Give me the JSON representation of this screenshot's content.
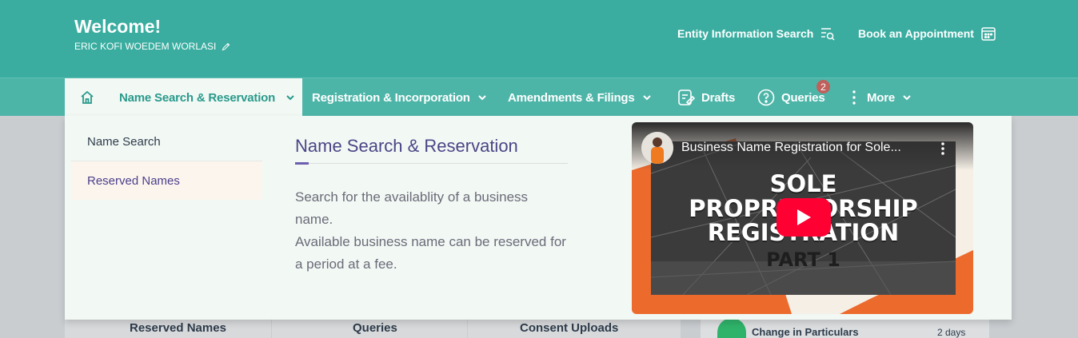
{
  "header": {
    "welcome": "Welcome!",
    "username": "ERIC KOFI WOEDEM WORLASI",
    "links": [
      {
        "label": "Entity Information Search"
      },
      {
        "label": "Book an Appointment"
      }
    ]
  },
  "nav": {
    "active_label": "Name Search & Reservation",
    "items": [
      {
        "label": "Registration & Incorporation"
      },
      {
        "label": "Amendments & Filings"
      },
      {
        "label": "Drafts"
      },
      {
        "label": "Queries"
      },
      {
        "label": "More"
      }
    ],
    "queries_badge": "2"
  },
  "dropdown": {
    "links": [
      {
        "label": "Name Search"
      },
      {
        "label": "Reserved Names"
      }
    ],
    "title": "Name Search & Reservation",
    "description_line1": "Search for the availablity of a business name.",
    "description_line2": "Available business name can be reserved for a period at a fee.",
    "video": {
      "title": "Business Name Registration for Sole...",
      "caption_lines": [
        "SOLE",
        "PROPRIETORSHIP",
        "REGISTRATION",
        "PART 1"
      ]
    }
  },
  "background": {
    "cards": [
      "Reserved Names",
      "Queries",
      "Consent Uploads"
    ],
    "activity_label": "Change in Particulars",
    "activity_time": "2 days"
  },
  "colors": {
    "header": "#3aada0",
    "nav": "#4db5a8",
    "active_text": "#2a9a8c",
    "title": "#4b4586",
    "badge": "#c0605c",
    "play": "#ff0033"
  }
}
